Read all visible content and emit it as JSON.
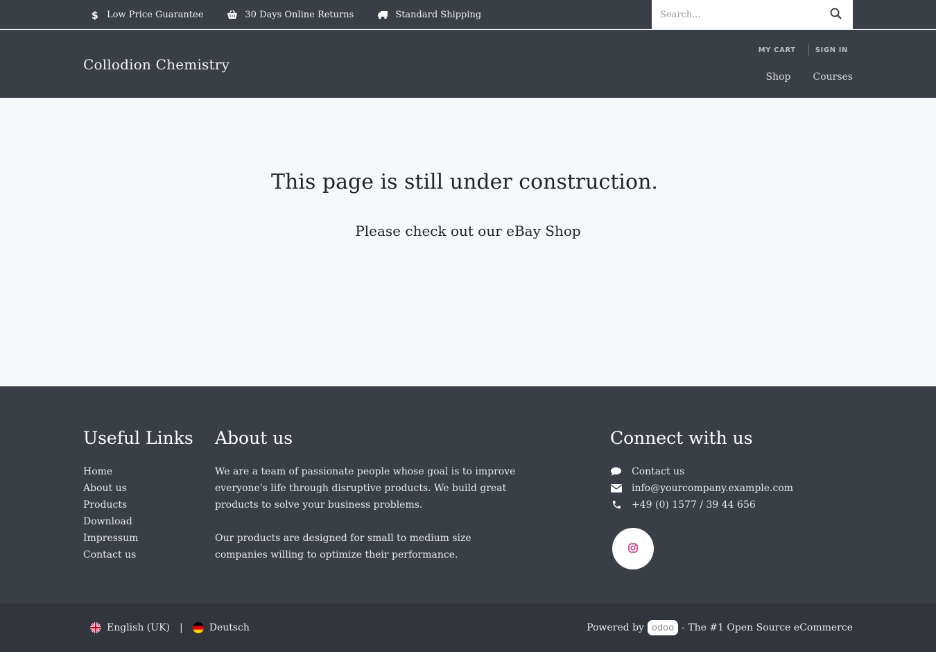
{
  "topbar": {
    "perks": [
      {
        "icon": "dollar-icon",
        "label": "Low Price Guarantee"
      },
      {
        "icon": "basket-icon",
        "label": "30 Days Online Returns"
      },
      {
        "icon": "truck-icon",
        "label": "Standard Shipping"
      }
    ],
    "search": {
      "placeholder": "Search...",
      "icon": "search-icon"
    }
  },
  "header": {
    "brand": "Collodion Chemistry",
    "account": {
      "cart": "MY CART",
      "sign_in": "SIGN IN"
    },
    "nav": [
      "Shop",
      "Courses"
    ]
  },
  "main": {
    "headline": "This page is still under construction.",
    "subline": "Please check out our eBay Shop"
  },
  "footer": {
    "useful_links": {
      "title": "Useful Links",
      "items": [
        "Home",
        "About us",
        "Products",
        "Download",
        "Impressum",
        "Contact us"
      ]
    },
    "about": {
      "title": "About us",
      "paragraphs": [
        "We are a team of passionate people whose goal is to improve everyone's life through disruptive products. We build great products to solve your business problems.",
        "Our products are designed for small to medium size companies willing to optimize their performance."
      ]
    },
    "connect": {
      "title": "Connect with us",
      "items": [
        {
          "icon": "chat-bubble-icon",
          "label": "Contact us"
        },
        {
          "icon": "envelope-icon",
          "label": "info@yourcompany.example.com"
        },
        {
          "icon": "phone-icon",
          "label": "+49 (0) 1577 / 39 44 656"
        }
      ],
      "social": {
        "icon": "instagram-icon",
        "color": "#c13584"
      }
    }
  },
  "bottombar": {
    "languages": [
      {
        "flag": "uk-flag-icon",
        "label": "English (UK)"
      },
      {
        "flag": "germany-flag-icon",
        "label": "Deutsch"
      }
    ],
    "separator": "|",
    "powered_by": "Powered by",
    "logo_text": "odoo",
    "tagline": "- The #1 Open Source eCommerce"
  },
  "colors": {
    "header_bg": "#3a3f46",
    "footer_bg": "#3a3f46",
    "bottombar_bg": "#32363c",
    "page_bg": "#f7f8fa"
  }
}
